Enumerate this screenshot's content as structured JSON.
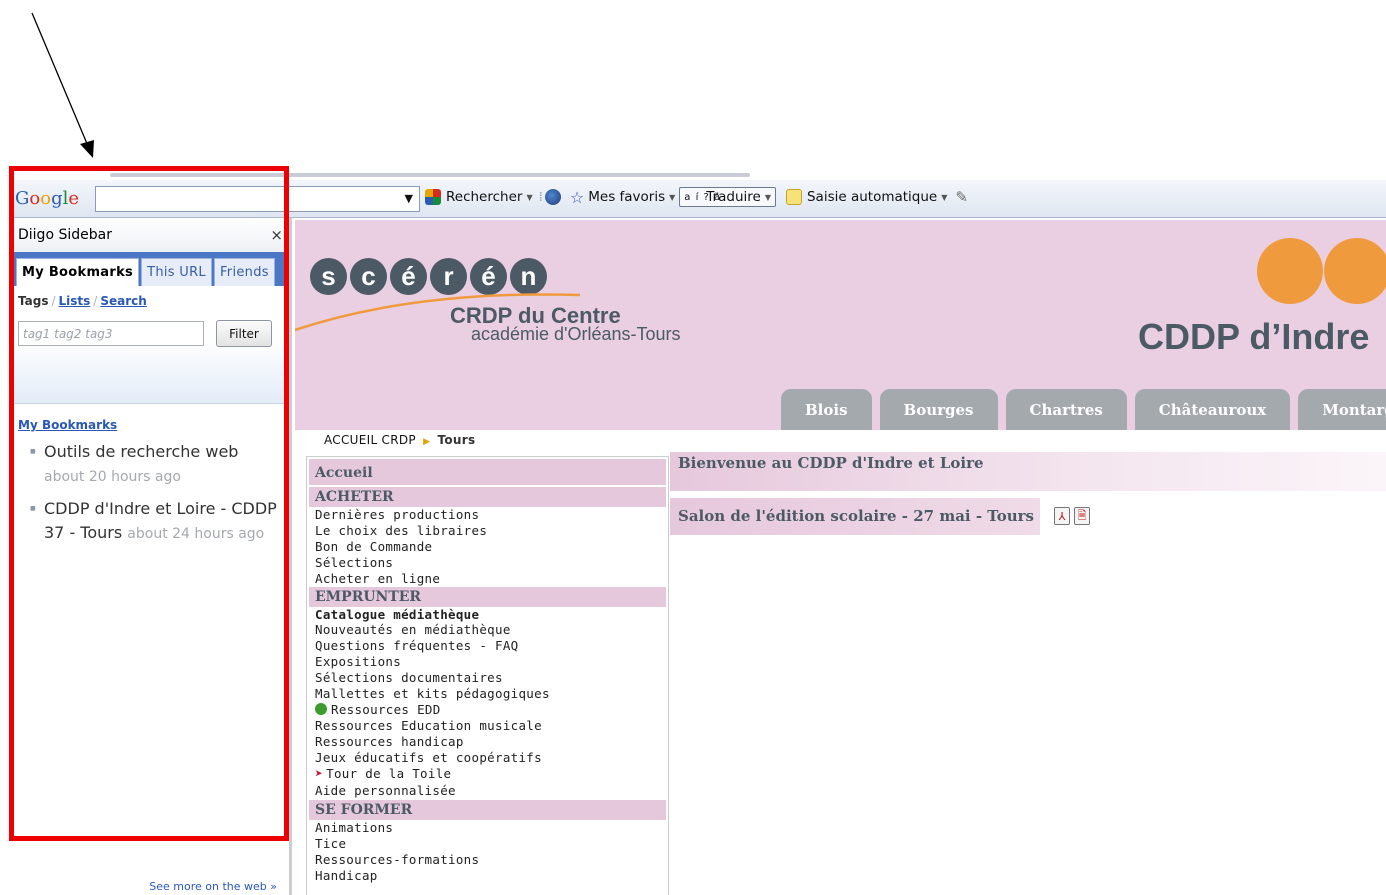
{
  "toolbar": {
    "logo": [
      "G",
      "o",
      "o",
      "g",
      "l",
      "e"
    ],
    "search_value": "",
    "search_button": "Rechercher",
    "bookmarks": "Mes favoris",
    "translate_glyphs": "a í ? ä",
    "translate": "Traduire",
    "autofill": "Saisie automatique"
  },
  "sidebar": {
    "title": "Diigo Sidebar",
    "close": "×",
    "tabs": [
      "My Bookmarks",
      "This URL",
      "Friends"
    ],
    "filter": {
      "label": "Tags",
      "links": [
        "Lists",
        "Search"
      ],
      "placeholder": "tag1 tag2 tag3",
      "button": "Filter"
    },
    "list_title": "My Bookmarks",
    "bookmarks": [
      {
        "title": "Outils de recherche web",
        "time": "about 20 hours ago"
      },
      {
        "title": "CDDP d'Indre et Loire - CDDP 37 - Tours",
        "time": "about 24 hours ago"
      }
    ],
    "footer": "See more on the web »"
  },
  "site": {
    "logo_letters": [
      "s",
      "c",
      "é",
      "r",
      "é",
      "n"
    ],
    "crdp_title": "CRDP du Centre",
    "crdp_subtitle": "académie d'Orléans-Tours",
    "cddp_title": "CDDP d’Indre",
    "tabs": [
      "Blois",
      "Bourges",
      "Chartres",
      "Châteauroux",
      "Montargis"
    ],
    "breadcrumb_home": "ACCUEIL CRDP",
    "breadcrumb_current": "Tours",
    "nav": {
      "accueil": "Accueil",
      "acheter": {
        "title": "ACHETER",
        "items": [
          "Dernières productions",
          "Le choix des libraires",
          "Bon de Commande",
          "Sélections",
          "Acheter en ligne"
        ]
      },
      "emprunter": {
        "title": "EMPRUNTER",
        "items": [
          "Catalogue médiathèque",
          "Nouveautés en médiathèque",
          "Questions fréquentes - FAQ",
          "Expositions",
          "Sélections documentaires",
          "Mallettes et kits pédagogiques",
          "Ressources EDD",
          "Ressources Education musicale",
          "Ressources handicap",
          "Jeux éducatifs et coopératifs",
          "Tour de la Toile",
          "Aide personnalisée"
        ]
      },
      "former": {
        "title": "SE FORMER",
        "items": [
          "Animations",
          "Tice",
          "Ressources-formations",
          "Handicap"
        ]
      }
    },
    "welcome": "Bienvenue au CDDP d'Indre et Loire",
    "news": "Salon de l'édition scolaire - 27 mai - Tours"
  },
  "colors": {
    "annotation_red": "#ee0000",
    "site_pink": "#e9cfe1",
    "site_gray": "#4c5a66",
    "logo_orange": "#f09a3e",
    "diigo_blue": "#4a78c6"
  }
}
